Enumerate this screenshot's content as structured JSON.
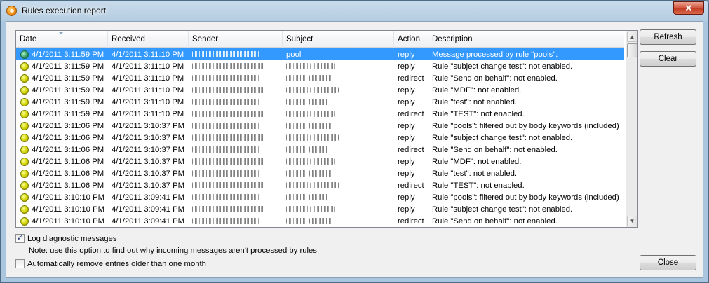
{
  "window": {
    "title": "Rules execution report",
    "close_glyph": "✕"
  },
  "columns": [
    "Date",
    "Received",
    "Sender",
    "Subject",
    "Action",
    "Description"
  ],
  "rows": [
    {
      "status": "green",
      "date": "4/1/2011 3:11:59 PM",
      "received": "4/1/2011 3:11:10 PM",
      "subject": "pool",
      "action": "reply",
      "description": "Message processed by rule \"pools\".",
      "selected": true
    },
    {
      "status": "yellow",
      "date": "4/1/2011 3:11:59 PM",
      "received": "4/1/2011 3:11:10 PM",
      "subject": "",
      "action": "reply",
      "description": "Rule \"subject change test\": not enabled."
    },
    {
      "status": "yellow",
      "date": "4/1/2011 3:11:59 PM",
      "received": "4/1/2011 3:11:10 PM",
      "subject": "",
      "action": "redirect",
      "description": "Rule \"Send on behalf\": not enabled."
    },
    {
      "status": "yellow",
      "date": "4/1/2011 3:11:59 PM",
      "received": "4/1/2011 3:11:10 PM",
      "subject": "",
      "action": "reply",
      "description": "Rule \"MDF\": not enabled."
    },
    {
      "status": "yellow",
      "date": "4/1/2011 3:11:59 PM",
      "received": "4/1/2011 3:11:10 PM",
      "subject": "",
      "action": "reply",
      "description": "Rule \"test\": not enabled."
    },
    {
      "status": "yellow",
      "date": "4/1/2011 3:11:59 PM",
      "received": "4/1/2011 3:11:10 PM",
      "subject": "",
      "action": "redirect",
      "description": "Rule \"TEST\": not enabled."
    },
    {
      "status": "yellow",
      "date": "4/1/2011 3:11:06 PM",
      "received": "4/1/2011 3:10:37 PM",
      "subject": "",
      "action": "reply",
      "description": "Rule \"pools\": filtered out by body keywords (included)"
    },
    {
      "status": "yellow",
      "date": "4/1/2011 3:11:06 PM",
      "received": "4/1/2011 3:10:37 PM",
      "subject": "",
      "action": "reply",
      "description": "Rule \"subject change test\": not enabled."
    },
    {
      "status": "yellow",
      "date": "4/1/2011 3:11:06 PM",
      "received": "4/1/2011 3:10:37 PM",
      "subject": "",
      "action": "redirect",
      "description": "Rule \"Send on behalf\": not enabled."
    },
    {
      "status": "yellow",
      "date": "4/1/2011 3:11:06 PM",
      "received": "4/1/2011 3:10:37 PM",
      "subject": "",
      "action": "reply",
      "description": "Rule \"MDF\": not enabled."
    },
    {
      "status": "yellow",
      "date": "4/1/2011 3:11:06 PM",
      "received": "4/1/2011 3:10:37 PM",
      "subject": "",
      "action": "reply",
      "description": "Rule \"test\": not enabled."
    },
    {
      "status": "yellow",
      "date": "4/1/2011 3:11:06 PM",
      "received": "4/1/2011 3:10:37 PM",
      "subject": "",
      "action": "redirect",
      "description": "Rule \"TEST\": not enabled."
    },
    {
      "status": "yellow",
      "date": "4/1/2011 3:10:10 PM",
      "received": "4/1/2011 3:09:41 PM",
      "subject": "",
      "action": "reply",
      "description": "Rule \"pools\": filtered out by body keywords (included)"
    },
    {
      "status": "yellow",
      "date": "4/1/2011 3:10:10 PM",
      "received": "4/1/2011 3:09:41 PM",
      "subject": "",
      "action": "reply",
      "description": "Rule \"subject change test\": not enabled."
    },
    {
      "status": "yellow",
      "date": "4/1/2011 3:10:10 PM",
      "received": "4/1/2011 3:09:41 PM",
      "subject": "",
      "action": "redirect",
      "description": "Rule \"Send on behalf\": not enabled."
    }
  ],
  "buttons": {
    "refresh": "Refresh",
    "clear": "Clear",
    "close": "Close"
  },
  "options": {
    "log_diagnostic": {
      "label": "Log diagnostic messages",
      "checked": true
    },
    "note": "Note: use this option to find out why incoming messages aren't processed by rules",
    "auto_remove": {
      "label": "Automatically remove entries older than one month",
      "checked": false
    }
  },
  "colors": {
    "selection": "#3399ff",
    "status_green": "#3aa36a",
    "status_yellow": "#d4d400"
  }
}
